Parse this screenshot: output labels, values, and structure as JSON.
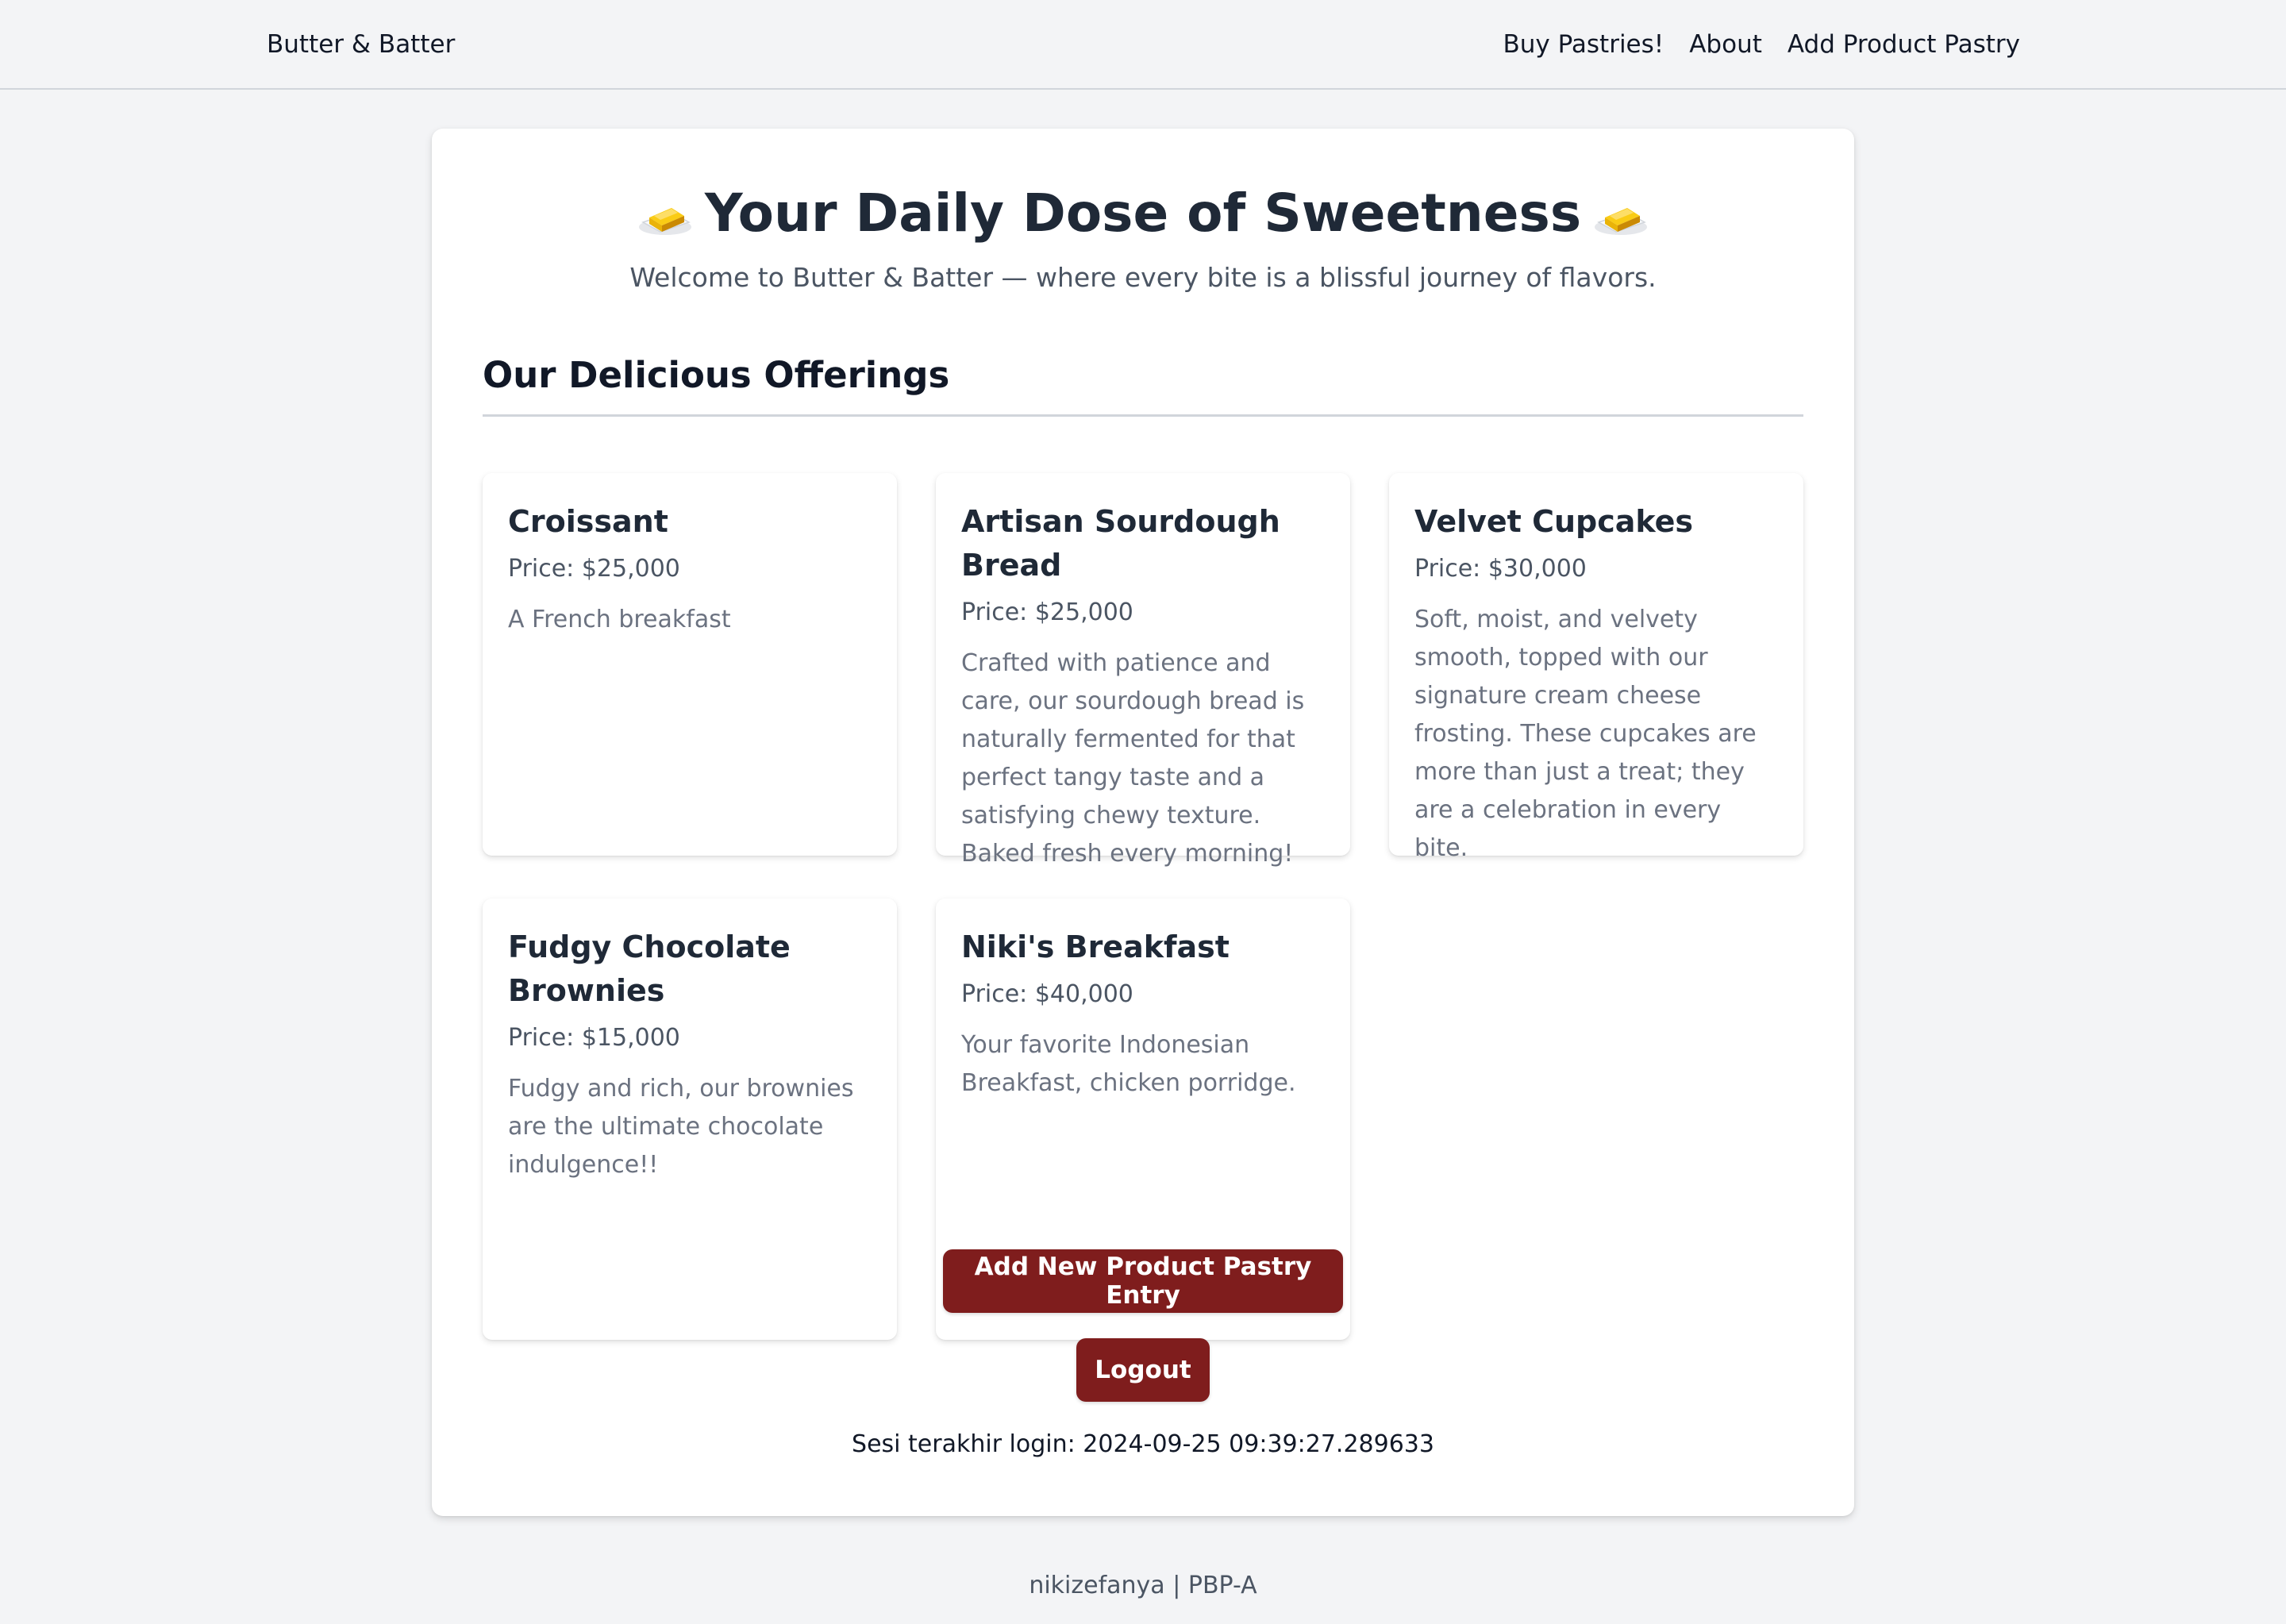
{
  "navbar": {
    "brand": "Butter & Batter",
    "links": [
      "Buy Pastries!",
      "About",
      "Add Product Pastry"
    ]
  },
  "hero": {
    "title": "Your Daily Dose of Sweetness",
    "subtitle": "Welcome to Butter & Batter — where every bite is a blissful journey of flavors.",
    "icon": "butter-icon"
  },
  "section": {
    "title": "Our Delicious Offerings"
  },
  "products": [
    {
      "name": "Croissant",
      "price": "Price: $25,000",
      "description": "A French breakfast"
    },
    {
      "name": "Artisan Sourdough Bread",
      "price": "Price: $25,000",
      "description": "Crafted with patience and care, our sourdough bread is naturally fermented for that perfect tangy taste and a satisfying chewy texture. Baked fresh every morning!"
    },
    {
      "name": "Velvet Cupcakes",
      "price": "Price: $30,000",
      "description": "Soft, moist, and velvety smooth, topped with our signature cream cheese frosting. These cupcakes are more than just a treat; they are a celebration in every bite."
    },
    {
      "name": "Fudgy Chocolate Brownies",
      "price": "Price: $15,000",
      "description": "Fudgy and rich, our brownies are the ultimate chocolate indulgence!!"
    },
    {
      "name": "Niki's Breakfast",
      "price": "Price: $40,000",
      "description": "Your favorite Indonesian Breakfast, chicken porridge."
    }
  ],
  "actions": {
    "add_label": "Add New Product Pastry Entry",
    "logout_label": "Logout"
  },
  "session": {
    "last_login": "Sesi terakhir login: 2024-09-25 09:39:27.289633"
  },
  "footer": {
    "text": "nikizefanya | PBP-A"
  },
  "colors": {
    "accent": "#7f1d1d",
    "background": "#f3f4f6"
  }
}
